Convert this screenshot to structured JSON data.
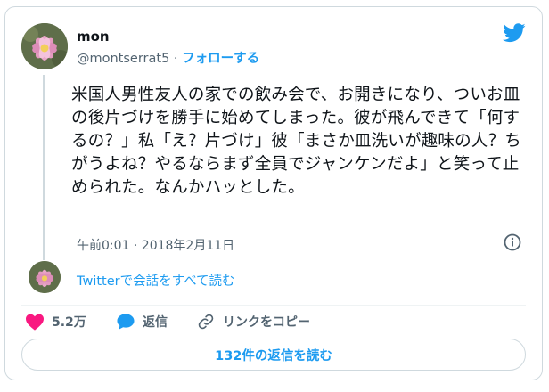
{
  "user": {
    "display_name": "mon",
    "handle": "@montserrat5",
    "separator": "·",
    "follow_label": "フォローする"
  },
  "tweet": {
    "text": "米国人男性友人の家での飲み会で、お開きになり、ついお皿の後片づけを勝手に始めてしまった。彼が飛んできて「何するの？」私「え？片づけ」彼「まさか皿洗いが趣味の人？ちがうよね？やるならまず全員でジャンケンだよ」と笑って止められた。なんかハッとした。",
    "timestamp": "午前0:01 · 2018年2月11日"
  },
  "thread": {
    "read_conversation": "Twitterで会話をすべて読む"
  },
  "actions": {
    "like_count": "5.2万",
    "reply_label": "返信",
    "copy_link_label": "リンクをコピー"
  },
  "footer": {
    "read_replies": "132件の返信を読む"
  },
  "icons": {
    "brand": "twitter-bird-icon",
    "info": "info-icon",
    "like": "heart-icon",
    "reply": "speech-bubble-icon",
    "link": "link-icon"
  },
  "colors": {
    "accent": "#1d9bf0",
    "like": "#f91880",
    "text": "#0f1419",
    "muted": "#536471",
    "border": "#cfd9de"
  }
}
